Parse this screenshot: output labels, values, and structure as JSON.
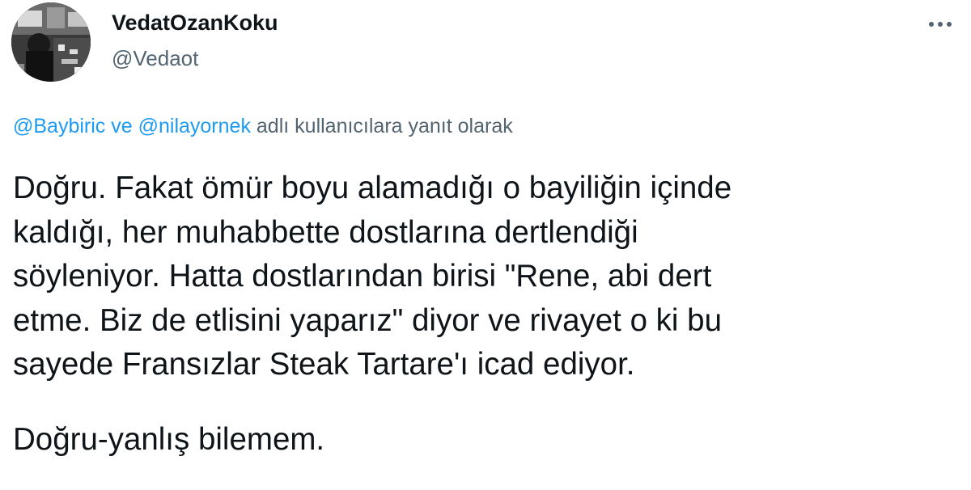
{
  "author": {
    "display_name": "VedatOzanKoku",
    "handle": "@Vedaot"
  },
  "actions": {
    "more_icon": "more-horizontal-icon"
  },
  "reply_context": {
    "mention_1": "@Baybiric",
    "connector": "ve",
    "mention_2": "@nilayornek",
    "suffix": "adlı kullanıcılara yanıt olarak"
  },
  "tweet": {
    "lines": [
      "Doğru. Fakat ömür boyu alamadığı o bayiliğin içinde",
      "kaldığı, her muhabbette dostlarına dertlendiği",
      "söyleniyor. Hatta dostlarından birisi \"Rene, abi dert",
      "etme. Biz de etlisini yaparız\" diyor ve rivayet o ki bu",
      "sayede Fransızlar Steak Tartare'ı icad ediyor."
    ],
    "closing_line": "Doğru-yanlış bilemem."
  },
  "colors": {
    "text": "#0f1419",
    "secondary": "#536471",
    "accent": "#1d9bf0"
  }
}
